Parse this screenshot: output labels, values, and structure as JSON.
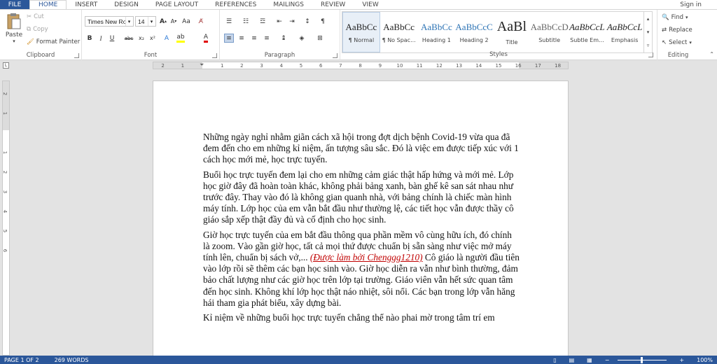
{
  "tabs": {
    "file": "FILE",
    "home": "HOME",
    "insert": "INSERT",
    "design": "DESIGN",
    "page_layout": "PAGE LAYOUT",
    "references": "REFERENCES",
    "mailings": "MAILINGS",
    "review": "REVIEW",
    "view": "VIEW",
    "signin": "Sign in"
  },
  "clipboard": {
    "label": "Clipboard",
    "paste": "Paste",
    "cut": "Cut",
    "copy": "Copy",
    "format_painter": "Format Painter"
  },
  "font": {
    "label": "Font",
    "name": "Times New Ro",
    "size": "14"
  },
  "paragraph": {
    "label": "Paragraph"
  },
  "styles": {
    "label": "Styles",
    "items": [
      {
        "preview": "AaBbCc",
        "name": "¶ Normal"
      },
      {
        "preview": "AaBbCc",
        "name": "¶ No Spac..."
      },
      {
        "preview": "AaBbCc",
        "name": "Heading 1"
      },
      {
        "preview": "AaBbCcC",
        "name": "Heading 2"
      },
      {
        "preview": "AaBl",
        "name": "Title"
      },
      {
        "preview": "AaBbCcD",
        "name": "Subtitle"
      },
      {
        "preview": "AaBbCcL",
        "name": "Subtle Em..."
      },
      {
        "preview": "AaBbCcL",
        "name": "Emphasis"
      }
    ]
  },
  "editing": {
    "label": "Editing",
    "find": "Find",
    "replace": "Replace",
    "select": "Select"
  },
  "ruler": {
    "numbers": [
      "2",
      "1",
      "1",
      "2",
      "3",
      "4",
      "5",
      "6",
      "7",
      "8",
      "9",
      "10",
      "11",
      "12",
      "13",
      "14",
      "15",
      "16",
      "17",
      "18"
    ]
  },
  "vruler": {
    "numbers": [
      "2",
      "1",
      "1",
      "2",
      "3",
      "4",
      "5",
      "6"
    ]
  },
  "document": {
    "p1": "Những ngày nghỉ nhằm giãn cách xã hội trong đợt dịch bệnh Covid-19 vừa qua đã đem đến cho em những kỉ niệm, ấn tượng sâu sắc. Đó là việc em được tiếp xúc với 1 cách học mới mẻ, học trực tuyến.",
    "p2": "Buổi học trực tuyến đem lại cho em những cảm giác thật hấp hứng và mới mẻ. Lớp học giờ đây đã hoàn toàn khác, không phải bảng xanh, bàn ghế kê san sát nhau như trước đây. Thay vào đó  là không gian quanh nhà, với bảng chính là chiếc màn hình máy tính. Lớp học của em vẫn bắt đầu như thường lệ, các tiết học vẫn được thầy cô giáo sắp xếp thật đầy đủ và cố định cho học sinh.",
    "p3a": "Giờ học trực tuyến của em bắt đầu thông qua phần mềm vô cùng hữu ích, đó chính là zoom. Vào gần giờ học, tất cả mọi thứ được chuẩn bị sẵn sàng như việc mở máy tính lên, chuẩn bị sách vở,... ",
    "p3red": "(Được làm bởi Chenggg1210)",
    "p3b": " Cô giáo là người đầu tiên vào lớp rồi sẽ thêm các bạn học sinh vào. Giờ học diễn ra vẫn như bình thường, đảm bảo chất lượng như các giờ học trên lớp tại trường. Giáo viên vẫn hết sức quan tâm đến học sinh. Không khí lớp học thật náo nhiệt, sôi nổi. Các bạn trong lớp vẫn hăng hái tham gia phát biểu, xây dựng bài.",
    "p4": "Kỉ niệm về những buổi học trực tuyến chẳng thể nào phai mờ trong tâm trí em"
  },
  "status": {
    "page": "PAGE 1 OF 2",
    "words": "269 WORDS",
    "zoom": "100%"
  },
  "colors": {
    "accent": "#2b579a",
    "red_text": "#c00000"
  }
}
